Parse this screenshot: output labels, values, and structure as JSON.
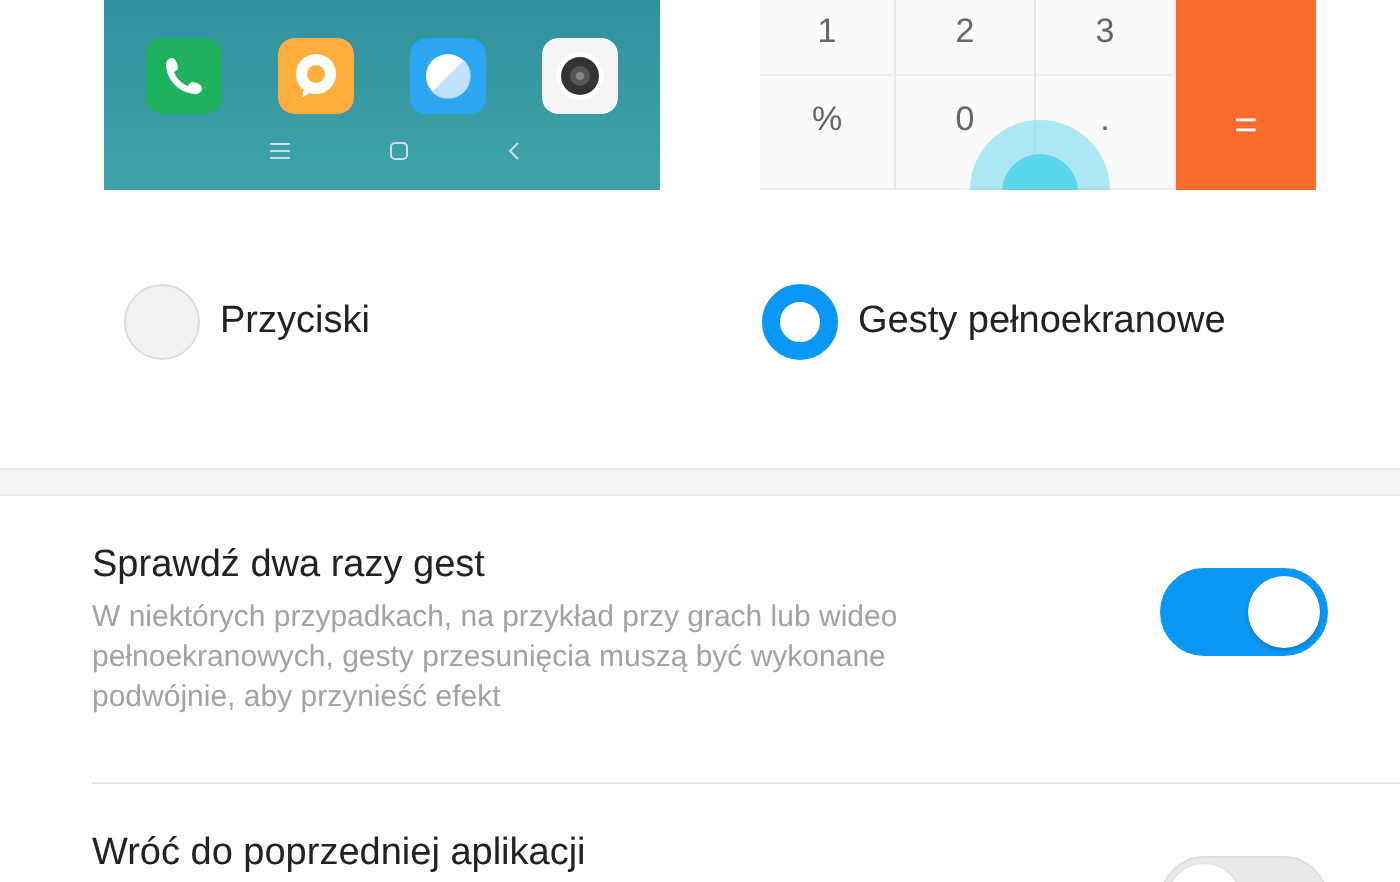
{
  "calculator": {
    "keys": [
      {
        "label": "1",
        "kind": "digit"
      },
      {
        "label": "2",
        "kind": "digit"
      },
      {
        "label": "3",
        "kind": "digit"
      },
      {
        "label": "%",
        "kind": "digit"
      },
      {
        "label": "0",
        "kind": "digit"
      },
      {
        "label": ".",
        "kind": "digit"
      }
    ],
    "equals": "="
  },
  "navigation_options": [
    {
      "label": "Przyciski",
      "selected": false
    },
    {
      "label": "Gesty pełnoekranowe",
      "selected": true
    }
  ],
  "settings": [
    {
      "title": "Sprawdź dwa razy gest",
      "description": "W niektórych przypadkach, na przykład przy grach lub wideo pełnoekranowych, gesty przesunięcia muszą być wykonane podwójnie, aby przynieść efekt",
      "on": true
    },
    {
      "title": "Wróć do poprzedniej aplikacji",
      "on": false
    }
  ]
}
